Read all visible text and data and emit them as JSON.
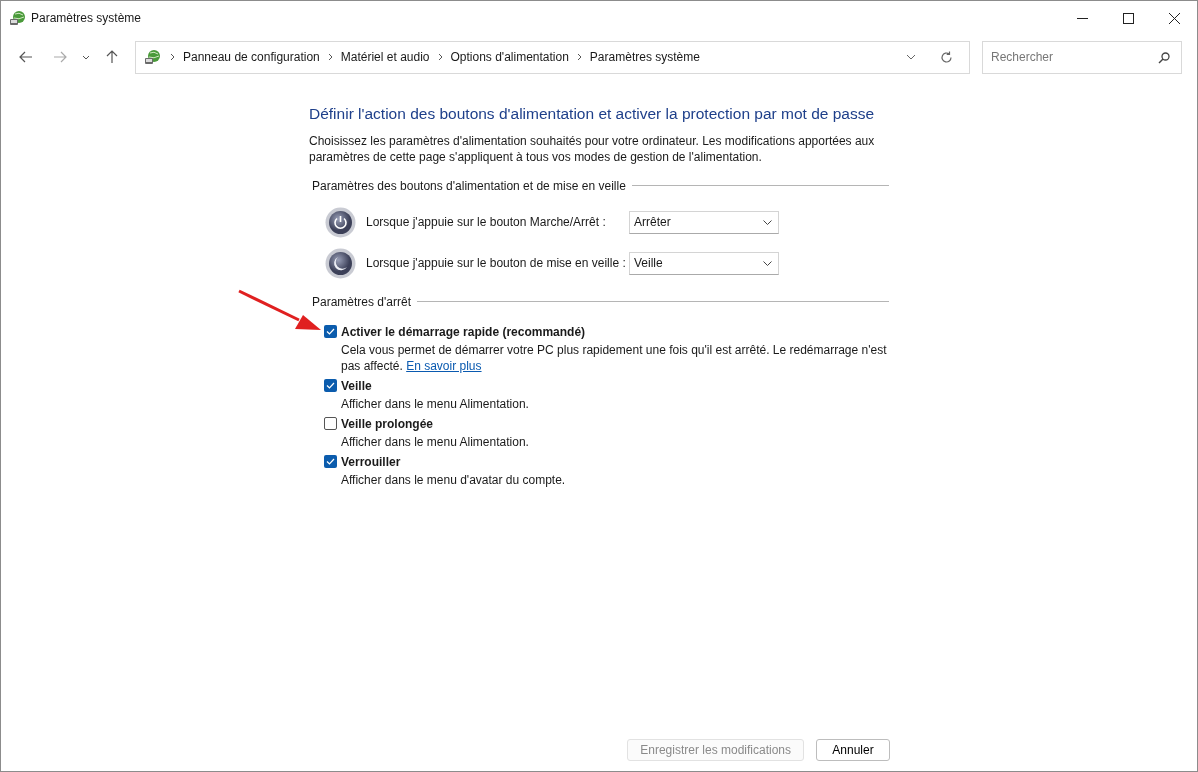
{
  "window": {
    "title": "Paramètres système"
  },
  "address_bar": {
    "breadcrumb": [
      "Panneau de configuration",
      "Matériel et audio",
      "Options d'alimentation",
      "Paramètres système"
    ]
  },
  "search": {
    "placeholder": "Rechercher"
  },
  "heading": "Définir l'action des boutons d'alimentation et activer la protection par mot de passe",
  "intro": "Choisissez les paramètres d'alimentation souhaités pour votre ordinateur. Les modifications apportées aux paramètres de cette page s'appliquent à tous vos modes de gestion de l'alimentation.",
  "power_section": {
    "title": "Paramètres des boutons d'alimentation et de mise en veille",
    "rows": [
      {
        "kind": "power",
        "label": "Lorsque j'appuie sur le bouton Marche/Arrêt :",
        "value": "Arrêter"
      },
      {
        "kind": "sleep",
        "label": "Lorsque j'appuie sur le bouton de mise en veille :",
        "value": "Veille"
      }
    ]
  },
  "shutdown_section": {
    "title": "Paramètres d'arrêt",
    "options": [
      {
        "label": "Activer le démarrage rapide (recommandé)",
        "description": "Cela vous permet de démarrer votre PC plus rapidement une fois qu'il est arrêté. Le redémarrage n'est pas affecté.",
        "link": "En savoir plus",
        "checked": true
      },
      {
        "label": "Veille",
        "description": "Afficher dans le menu Alimentation.",
        "checked": true
      },
      {
        "label": "Veille prolongée",
        "description": "Afficher dans le menu Alimentation.",
        "checked": false
      },
      {
        "label": "Verrouiller",
        "description": "Afficher dans le menu d'avatar du compte.",
        "checked": true
      }
    ]
  },
  "buttons": [
    {
      "label": "Enregistrer les modifications",
      "disabled": true
    },
    {
      "label": "Annuler",
      "disabled": false
    }
  ]
}
